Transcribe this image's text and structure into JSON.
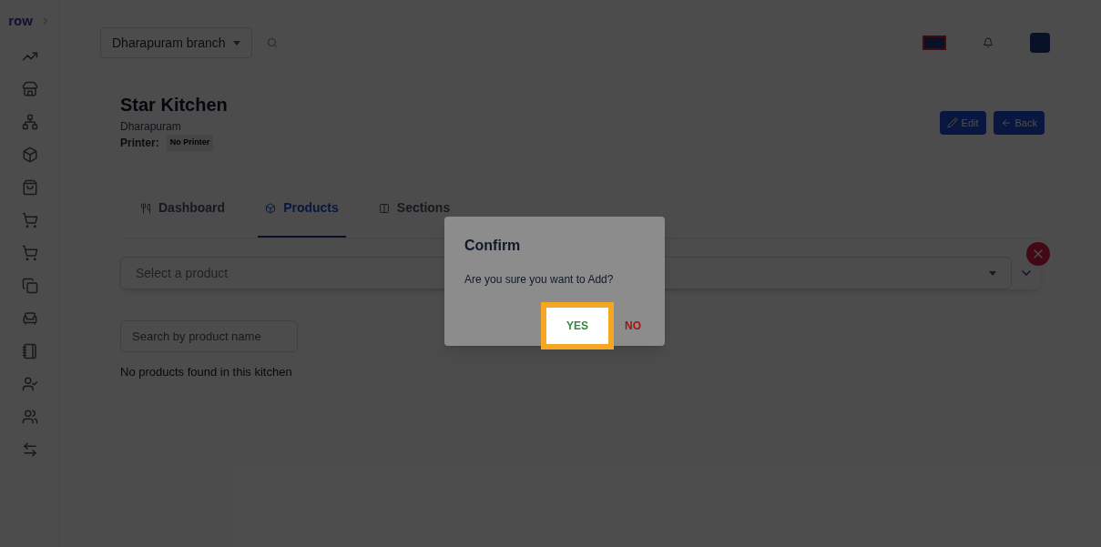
{
  "logo": "row",
  "branch_select": {
    "value": "Dharapuram branch"
  },
  "kitchen": {
    "title": "Star Kitchen",
    "location": "Dharapuram",
    "printer_label": "Printer:",
    "printer_value": "No Printer"
  },
  "actions": [
    "Edit",
    "Back"
  ],
  "tabs": [
    {
      "label": "Dashboard",
      "selected": false
    },
    {
      "label": "Products",
      "selected": true
    },
    {
      "label": "Sections",
      "selected": false
    }
  ],
  "product_select": {
    "placeholder": "Select a product"
  },
  "search": {
    "placeholder": "Search by product name"
  },
  "empty_message": "No products found in this kitchen",
  "dialog": {
    "title": "Confirm",
    "message": "Are you sure you want to Add?",
    "yes": "YES",
    "no": "NO",
    "yes_highlighted": true
  }
}
